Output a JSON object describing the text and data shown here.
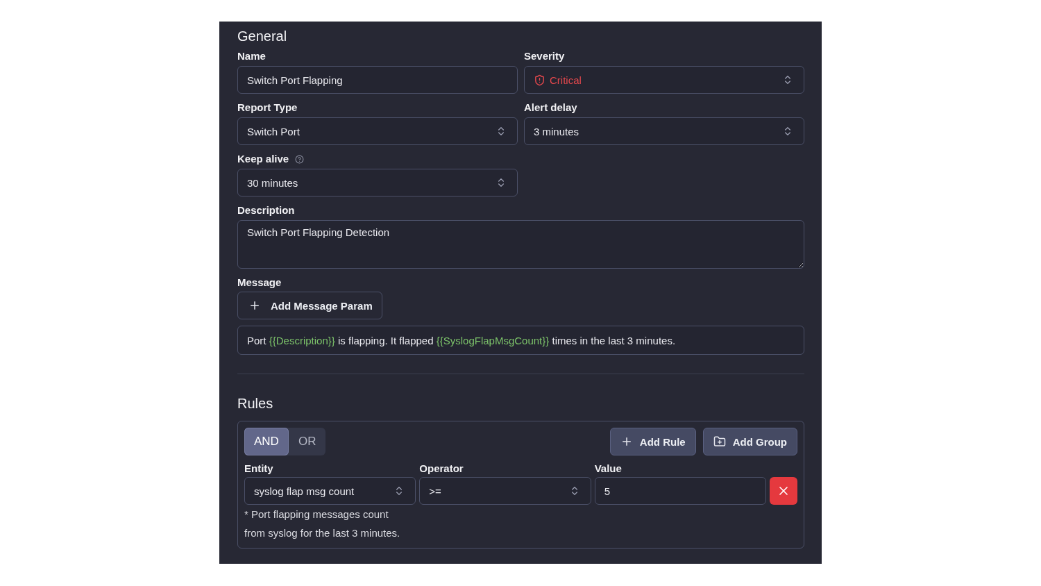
{
  "general": {
    "title": "General",
    "fields": [
      {
        "kind": "text",
        "label": "Name",
        "value": "Switch Port Flapping",
        "help": false
      },
      {
        "kind": "severity",
        "label": "Severity",
        "value": "Critical",
        "help": false
      },
      {
        "kind": "select",
        "label": "Report Type",
        "value": "Switch Port",
        "help": false
      },
      {
        "kind": "select",
        "label": "Alert delay",
        "value": "3 minutes",
        "help": false
      },
      {
        "kind": "select",
        "label": "Keep alive",
        "value": "30 minutes",
        "help": true
      },
      {
        "kind": "textarea",
        "label": "Description",
        "value": "Switch Port Flapping Detection",
        "help": false
      }
    ]
  },
  "message": {
    "label": "Message",
    "add_button": "Add Message Param",
    "parts": [
      {
        "kind": "text",
        "text": "Port "
      },
      {
        "kind": "param",
        "text": "{{Description}}"
      },
      {
        "kind": "text",
        "text": " is flapping. It flapped "
      },
      {
        "kind": "param",
        "text": "{{SyslogFlapMsgCount}}"
      },
      {
        "kind": "text",
        "text": " times in the last 3 minutes."
      }
    ]
  },
  "rules": {
    "title": "Rules",
    "combinators": [
      {
        "label": "AND",
        "selected": true
      },
      {
        "label": "OR",
        "selected": false
      }
    ],
    "actions": [
      {
        "kind": "rule",
        "label": "Add Rule"
      },
      {
        "kind": "group",
        "label": "Add Group"
      }
    ],
    "rule": {
      "fields": [
        {
          "kind": "select",
          "label": "Entity",
          "value": "syslog flap msg count"
        },
        {
          "kind": "select",
          "label": "Operator",
          "value": ">="
        },
        {
          "kind": "text",
          "label": "Value",
          "value": "5"
        }
      ],
      "note_lines": [
        "* Port flapping messages count",
        "from syslog for the last 3 minutes."
      ]
    }
  }
}
